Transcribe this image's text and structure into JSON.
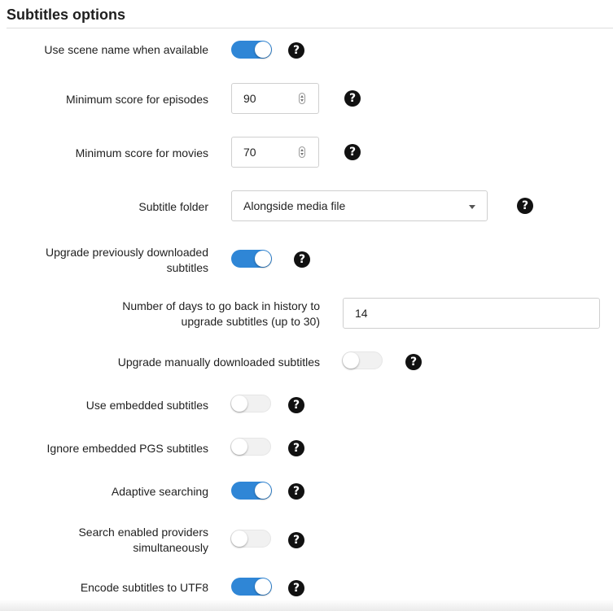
{
  "section": {
    "title": "Subtitles options"
  },
  "help_glyph": "?",
  "settings": {
    "use_scene_name": {
      "label": "Use scene name when available",
      "enabled": true
    },
    "min_score_episodes": {
      "label": "Minimum score for episodes",
      "value": "90"
    },
    "min_score_movies": {
      "label": "Minimum score for movies",
      "value": "70"
    },
    "subtitle_folder": {
      "label": "Subtitle folder",
      "value": "Alongside media file"
    },
    "upgrade_previous": {
      "label_line1": "Upgrade previously downloaded",
      "label_line2": "subtitles",
      "enabled": true
    },
    "upgrade_days": {
      "label_line1": "Number of days to go back in history to",
      "label_line2": "upgrade subtitles (up to 30)",
      "value": "14"
    },
    "upgrade_manual": {
      "label": "Upgrade manually downloaded subtitles",
      "enabled": false
    },
    "use_embedded": {
      "label": "Use embedded subtitles",
      "enabled": false
    },
    "ignore_pgs": {
      "label": "Ignore embedded PGS subtitles",
      "enabled": false
    },
    "adaptive_search": {
      "label": "Adaptive searching",
      "enabled": true
    },
    "search_simultaneous": {
      "label_line1": "Search enabled providers",
      "label_line2": "simultaneously",
      "enabled": false
    },
    "encode_utf8": {
      "label": "Encode subtitles to UTF8",
      "enabled": true
    }
  },
  "colors": {
    "toggle_on": "#2f86d6",
    "toggle_off": "#f1f1f1",
    "help_icon": "#111111"
  }
}
